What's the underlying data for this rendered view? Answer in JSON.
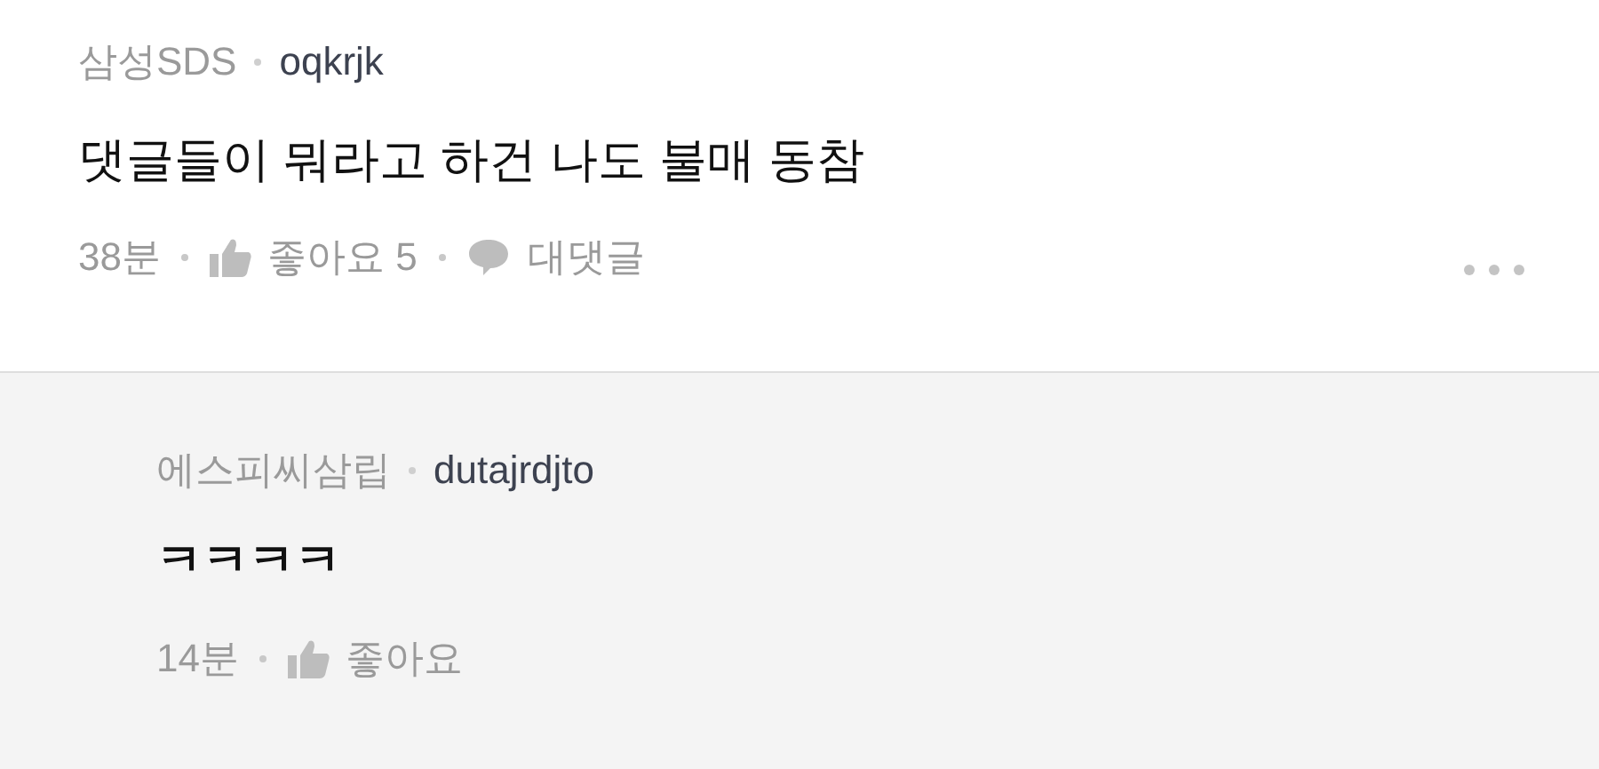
{
  "comment": {
    "company": "삼성SDS",
    "user": "oqkrjk",
    "text": "댓글들이 뭐라고 하건 나도 불매 동참",
    "time": "38분",
    "like_label": "좋아요 5",
    "reply_label": "대댓글"
  },
  "reply": {
    "company": "에스피씨삼립",
    "user": "dutajrdjto",
    "text": "ㅋㅋㅋㅋ",
    "time": "14분",
    "like_label": "좋아요"
  }
}
